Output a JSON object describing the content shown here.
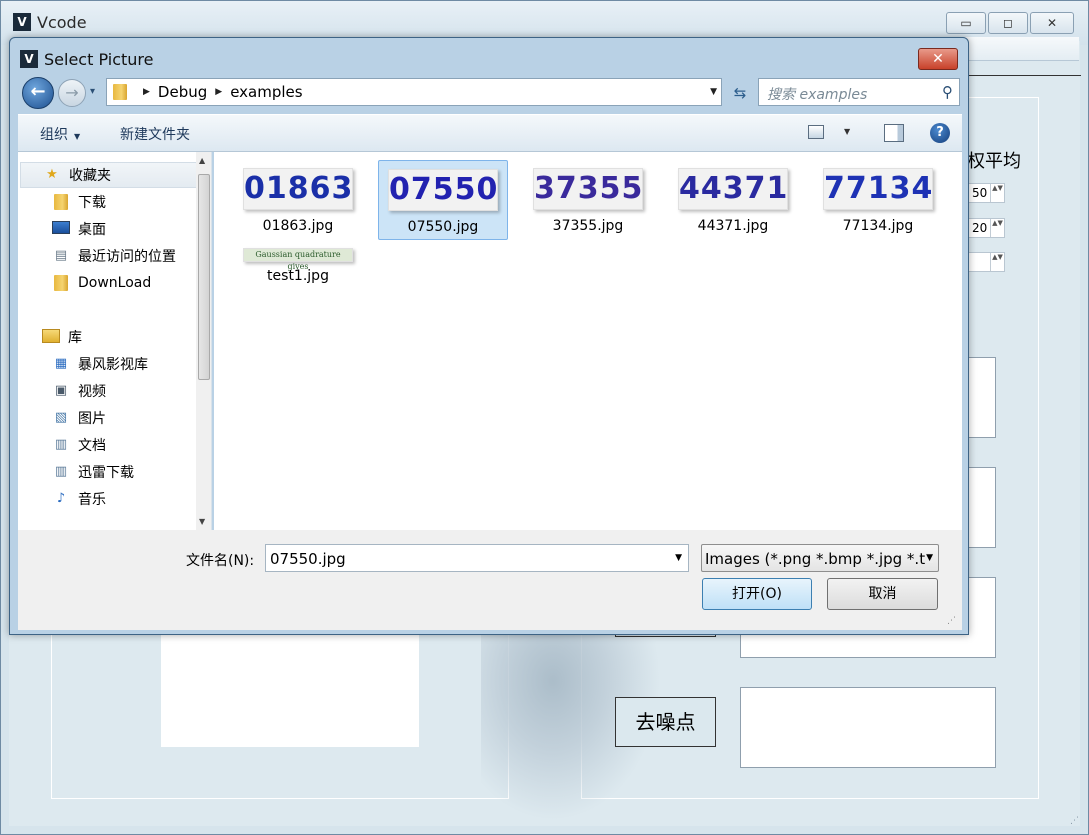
{
  "main": {
    "title": "Vcode",
    "app_icon": "V",
    "minimize": "▭",
    "maximize": "◻",
    "close": "✕",
    "partial_label": "权平均",
    "spin_values": [
      "50",
      "20",
      ""
    ],
    "spin_arrows": "▲▼",
    "denoise_label": "去噪点"
  },
  "dialog": {
    "title": "Select Picture",
    "app_icon": "V",
    "close": "✕",
    "nav": {
      "back": "←",
      "forward": "→",
      "history": "▾",
      "breadcrumb": [
        "Debug",
        "examples"
      ],
      "separator": "▶",
      "dropdown": "▼",
      "refresh": "⇆",
      "search_placeholder": "搜索 examples",
      "search_icon": "⚲"
    },
    "toolbar": {
      "organize": "组织",
      "organize_caret": "▼",
      "new_folder": "新建文件夹",
      "view_caret": "▼",
      "help": "?"
    },
    "sidebar": {
      "favorites": "收藏夹",
      "favorites_items": [
        "下载",
        "桌面",
        "最近访问的位置",
        "DownLoad"
      ],
      "libraries": "库",
      "library_items": [
        "暴风影视库",
        "视频",
        "图片",
        "文档",
        "迅雷下载",
        "音乐"
      ],
      "scroll_up": "▲",
      "scroll_down": "▼"
    },
    "files": [
      {
        "name": "01863.jpg",
        "text": "01863",
        "color": "#1a2fa8"
      },
      {
        "name": "07550.jpg",
        "text": "07550",
        "color": "#2222b0"
      },
      {
        "name": "37355.jpg",
        "text": "37355",
        "color": "#3a2a9c"
      },
      {
        "name": "44371.jpg",
        "text": "44371",
        "color": "#2a2aa0"
      },
      {
        "name": "77134.jpg",
        "text": "77134",
        "color": "#1e32b4"
      },
      {
        "name": "test1.jpg",
        "text": "Gaussian quadrature gives",
        "color": "#2a5a2a"
      }
    ],
    "selected_file": "07550.jpg",
    "bottom": {
      "filename_label": "文件名(N):",
      "filename_value": "07550.jpg",
      "filter": "Images (*.png *.bmp *.jpg *.t",
      "dropdown": "▼",
      "open": "打开(O)",
      "cancel": "取消",
      "grip": "⋰"
    }
  },
  "colors": {
    "accent": "#3c7fb1",
    "selection": "#cce4f7",
    "close_red": "#c8412a"
  }
}
